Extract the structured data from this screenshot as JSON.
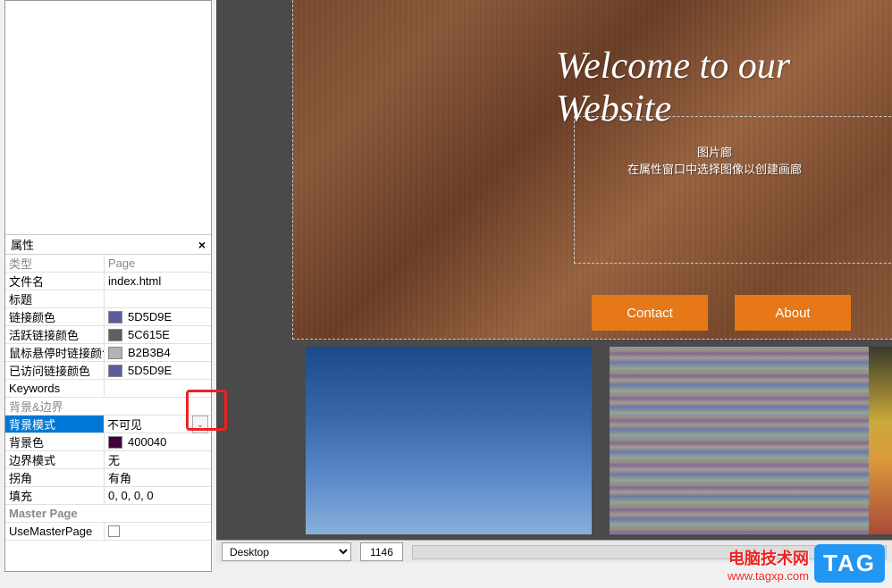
{
  "panel": {
    "title": "属性",
    "header": {
      "type_label": "类型",
      "type_value": "Page"
    },
    "rows": [
      {
        "label": "文件名",
        "value": "index.html",
        "kind": "text"
      },
      {
        "label": "标题",
        "value": "",
        "kind": "text"
      },
      {
        "label": "链接颜色",
        "value": "5D5D9E",
        "kind": "color",
        "swatch": "#5D5D9E"
      },
      {
        "label": "活跃链接颜色",
        "value": "5C615E",
        "kind": "color",
        "swatch": "#5C615E"
      },
      {
        "label": "鼠标悬停时链接颜色",
        "value": "B2B3B4",
        "kind": "color",
        "swatch": "#B2B3B4"
      },
      {
        "label": "已访问链接颜色",
        "value": "5D5D9E",
        "kind": "color",
        "swatch": "#5D5D9E"
      },
      {
        "label": "Keywords",
        "value": "",
        "kind": "text"
      }
    ],
    "section_bg": "背景&边界",
    "bg_rows": [
      {
        "label": "背景模式",
        "value": "不可见",
        "kind": "dropdown",
        "selected": true
      },
      {
        "label": "背景色",
        "value": "400040",
        "kind": "color",
        "swatch": "#400040"
      },
      {
        "label": "边界模式",
        "value": "无",
        "kind": "text"
      },
      {
        "label": "拐角",
        "value": "有角",
        "kind": "text"
      },
      {
        "label": "填充",
        "value": "0, 0, 0, 0",
        "kind": "text"
      }
    ],
    "section_master": "Master Page",
    "master_row": {
      "label": "UseMasterPage"
    }
  },
  "canvas": {
    "hero_title": "Welcome to our Website",
    "gallery_title": "图片廊",
    "gallery_hint": "在属性窗口中选择图像以创建画廊",
    "nav": {
      "contact": "Contact",
      "about": "About"
    }
  },
  "bottombar": {
    "device": "Desktop",
    "width": "1146"
  },
  "watermark": {
    "title": "电脑技术网",
    "url": "www.tagxp.com",
    "tag": "TAG"
  }
}
